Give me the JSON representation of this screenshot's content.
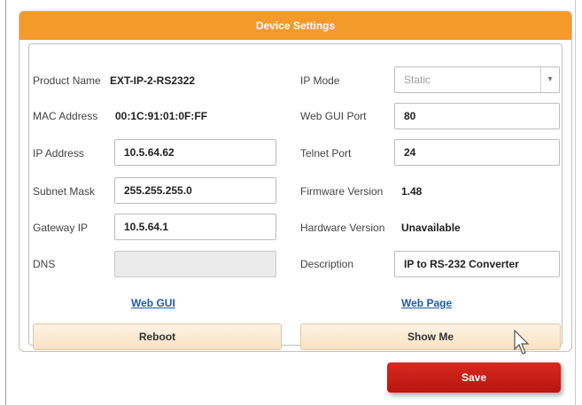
{
  "panel": {
    "title": "Device Settings"
  },
  "left": {
    "product_name": {
      "label": "Product Name",
      "value": "EXT-IP-2-RS2322"
    },
    "mac_address": {
      "label": "MAC Address",
      "value": "00:1C:91:01:0F:FF"
    },
    "ip_address": {
      "label": "IP Address",
      "value": "10.5.64.62"
    },
    "subnet_mask": {
      "label": "Subnet Mask",
      "value": "255.255.255.0"
    },
    "gateway_ip": {
      "label": "Gateway IP",
      "value": "10.5.64.1"
    },
    "dns": {
      "label": "DNS",
      "value": ""
    },
    "link": "Web GUI",
    "button": "Reboot"
  },
  "right": {
    "ip_mode": {
      "label": "IP Mode",
      "value": "Static"
    },
    "web_gui_port": {
      "label": "Web GUI Port",
      "value": "80"
    },
    "telnet_port": {
      "label": "Telnet Port",
      "value": "24"
    },
    "firmware_version": {
      "label": "Firmware Version",
      "value": "1.48"
    },
    "hardware_version": {
      "label": "Hardware Version",
      "value": "Unavailable"
    },
    "description": {
      "label": "Description",
      "value": "IP to RS-232 Converter"
    },
    "link": "Web Page",
    "button": "Show Me"
  },
  "footer": {
    "save": "Save"
  },
  "colors": {
    "header": "#f39a2b",
    "save": "#c91f17",
    "link": "#1f5aa6",
    "button_bg": "#fbe8cf"
  },
  "icons": {
    "dropdown": "chevron-down-icon",
    "cursor": "mouse-pointer-icon"
  }
}
